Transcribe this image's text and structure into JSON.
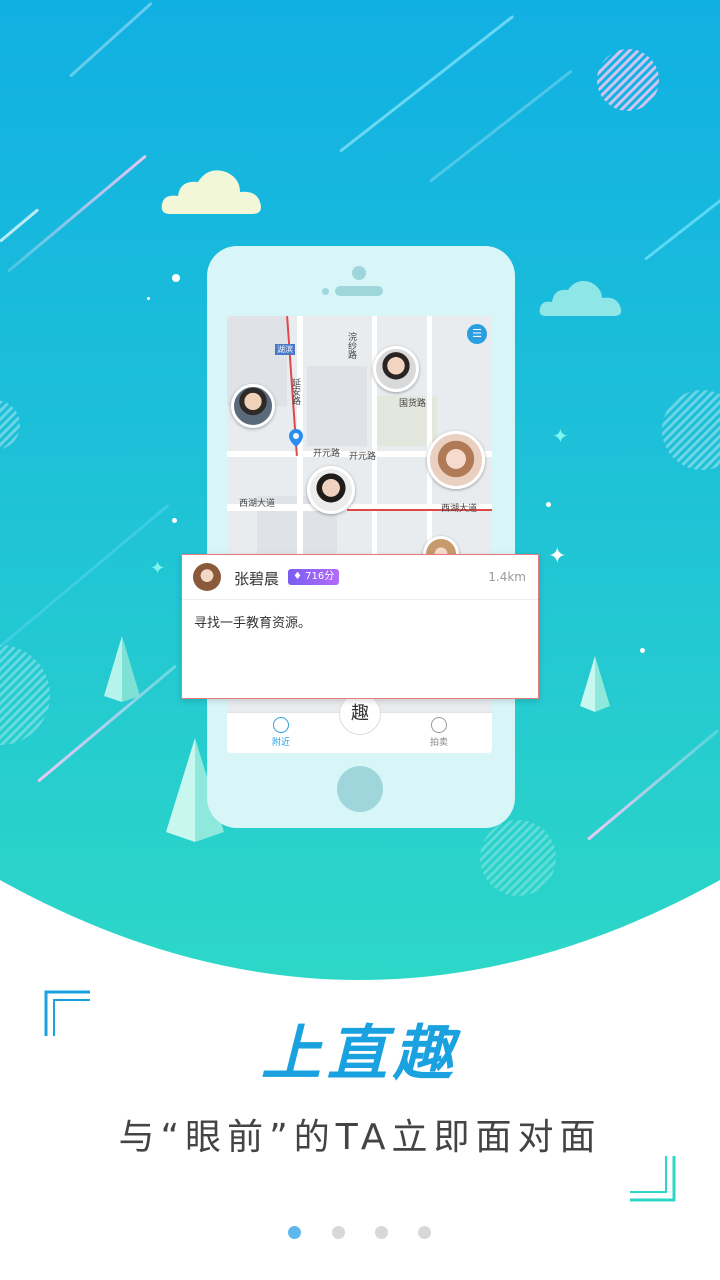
{
  "colors": {
    "accent": "#1aa2e0",
    "gradient_top": "#11b0e3",
    "gradient_bottom": "#2dd7c7",
    "card_border": "#e87c7c",
    "score_badge": "#8a5cf4",
    "dot_active": "#5eb8ec",
    "dot_inactive": "#d8d8d8"
  },
  "map": {
    "labels": {
      "kaiyuan_road": "开元路",
      "xihu_avenue_left": "西湖大道",
      "xihu_avenue_right": "西湖大道",
      "yanan_road": "延安路",
      "guohuo_road": "国货路",
      "huansha_road": "浣纱路",
      "hubin": "湖滨"
    },
    "list_icon": "list-icon"
  },
  "tabbar": {
    "nearby_label": "附近",
    "auction_label": "拍卖",
    "center_label": "趣",
    "nearby_icon": "compass-icon",
    "auction_icon": "gavel-icon"
  },
  "card": {
    "name": "张碧晨",
    "score": "716分",
    "score_icon": "flame-icon",
    "distance": "1.4km",
    "message": "寻找一手教育资源。"
  },
  "brand": {
    "title": "上直趣",
    "slogan": "与“眼前”的TA立即面对面"
  },
  "pagination": {
    "total": 4,
    "active_index": 0
  }
}
